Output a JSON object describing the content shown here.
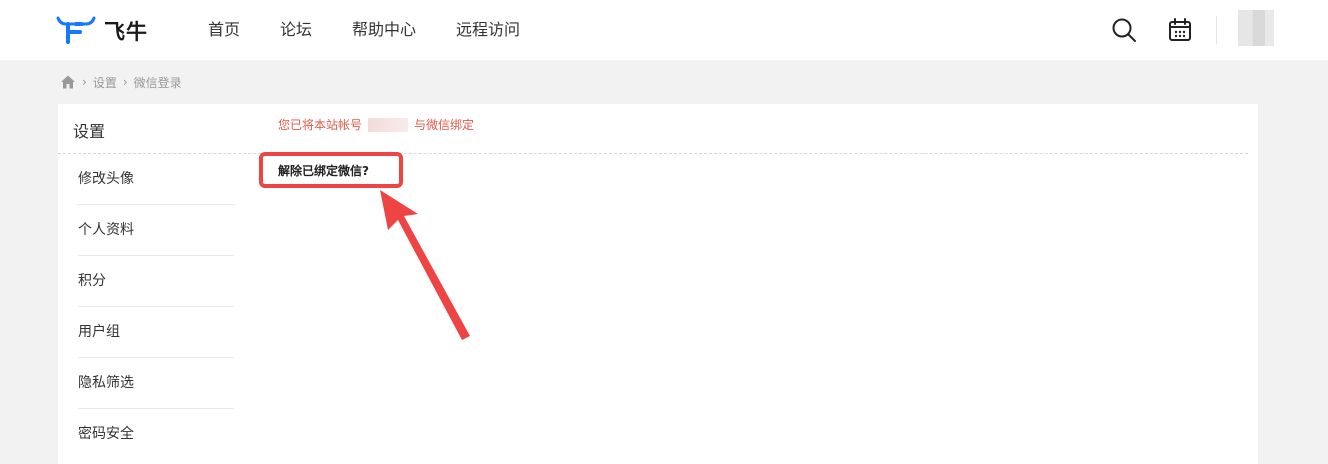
{
  "header": {
    "logo_text": "飞牛",
    "nav": [
      "首页",
      "论坛",
      "帮助中心",
      "远程访问"
    ]
  },
  "breadcrumb": [
    "设置",
    "微信登录"
  ],
  "sidebar": {
    "title": "设置",
    "items": [
      "修改头像",
      "个人资料",
      "积分",
      "用户组",
      "隐私筛选",
      "密码安全"
    ]
  },
  "content": {
    "bound_prefix": "您已将本站帐号",
    "bound_suffix": "与微信绑定",
    "unbind_label": "解除已绑定微信?"
  },
  "colors": {
    "accent": "#1677ff",
    "alert": "#e05a4a",
    "highlight": "#ee4444"
  }
}
